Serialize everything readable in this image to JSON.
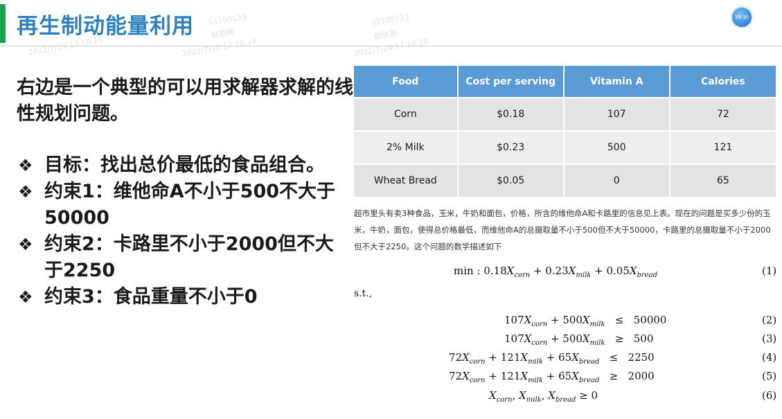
{
  "slide": {
    "title": "再生制动能量利用",
    "clock": "16:30",
    "watermarks": [
      "93100123",
      "鼓励赛",
      "2022/7/19 17:10:18"
    ]
  },
  "left": {
    "intro": "右边是一个典型的可以用求解器求解的线性规划问题。",
    "bullet_mark": "❖",
    "bullets": [
      "目标：找出总价最低的食品组合。",
      "约束1：维他命A不小于500不大于50000",
      "约束2：卡路里不小于2000但不大于2250",
      "约束3：食品重量不小于0"
    ]
  },
  "table": {
    "headers": [
      "Food",
      "Cost per serving",
      "Vitamin A",
      "Calories"
    ],
    "rows": [
      [
        "Corn",
        "$0.18",
        "107",
        "72"
      ],
      [
        "2% Milk",
        "$0.23",
        "500",
        "121"
      ],
      [
        "Wheat Bread",
        "$0.05",
        "0",
        "65"
      ]
    ]
  },
  "description": "超市里头有卖3种食品，玉米，牛奶和面包，价格，所含的维他命A和卡路里的信息见上表。现在的问题是买多少份的玉米，牛奶，面包，使得总价格最低，而维他命A的总摄取量不小于500但不大于50000，卡路里的总摄取量不小于2000但不大于2250。这个问题的数学描述如下",
  "math": {
    "objective_num": "(1)",
    "st_label": "s.t.,",
    "constraint_nums": [
      "(2)",
      "(3)",
      "(4)",
      "(5)",
      "(6)"
    ]
  }
}
